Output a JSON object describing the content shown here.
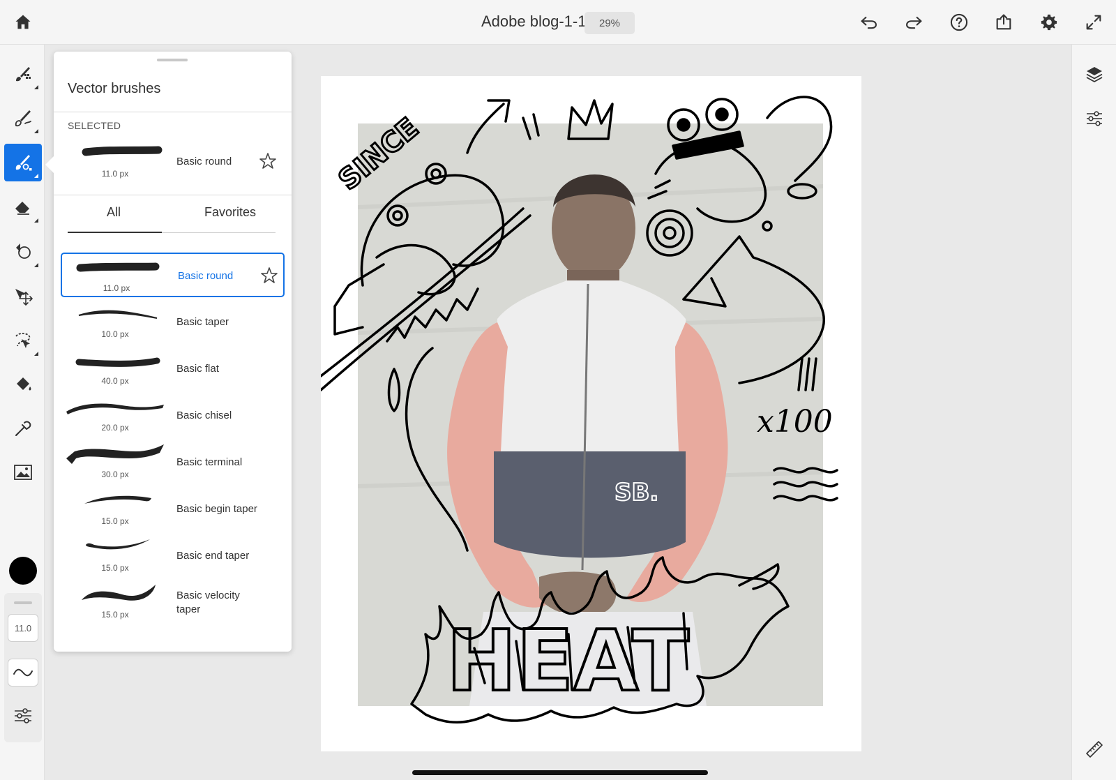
{
  "app": {
    "document_title": "Adobe blog-1-1",
    "zoom": "29%"
  },
  "topbar": {
    "icons": [
      "home-icon",
      "undo-icon",
      "redo-icon",
      "help-icon",
      "share-icon",
      "settings-icon",
      "fullscreen-icon"
    ]
  },
  "left_tools": {
    "icons": [
      "pixel-brush-icon",
      "live-brush-icon",
      "vector-brush-icon",
      "eraser-icon",
      "shape-icon",
      "transform-icon",
      "selection-icon",
      "fill-icon",
      "eyedropper-icon",
      "image-icon"
    ],
    "active": "vector-brush-icon",
    "color": "#000000",
    "brush_size": "11.0"
  },
  "right_tools": {
    "icons": [
      "layers-icon",
      "layer-properties-icon",
      "ruler-icon"
    ]
  },
  "brush_panel": {
    "title": "Vector brushes",
    "selected_label": "SELECTED",
    "selected_brush": {
      "name": "Basic round",
      "size": "11.0 px"
    },
    "tabs": {
      "all": "All",
      "favorites": "Favorites",
      "active": "All"
    },
    "brushes": [
      {
        "name": "Basic round",
        "size": "11.0 px"
      },
      {
        "name": "Basic taper",
        "size": "10.0 px"
      },
      {
        "name": "Basic flat",
        "size": "40.0 px"
      },
      {
        "name": "Basic chisel",
        "size": "20.0 px"
      },
      {
        "name": "Basic terminal",
        "size": "30.0 px"
      },
      {
        "name": "Basic begin taper",
        "size": "15.0 px"
      },
      {
        "name": "Basic end taper",
        "size": "15.0 px"
      },
      {
        "name": "Basic velocity taper",
        "size": "15.0 px"
      }
    ],
    "accent": "#1473e6"
  },
  "canvas": {
    "texts": {
      "since": "SINCE",
      "multiplier": "x100",
      "heat": "HEAT",
      "jacket_logo": "SB."
    }
  }
}
